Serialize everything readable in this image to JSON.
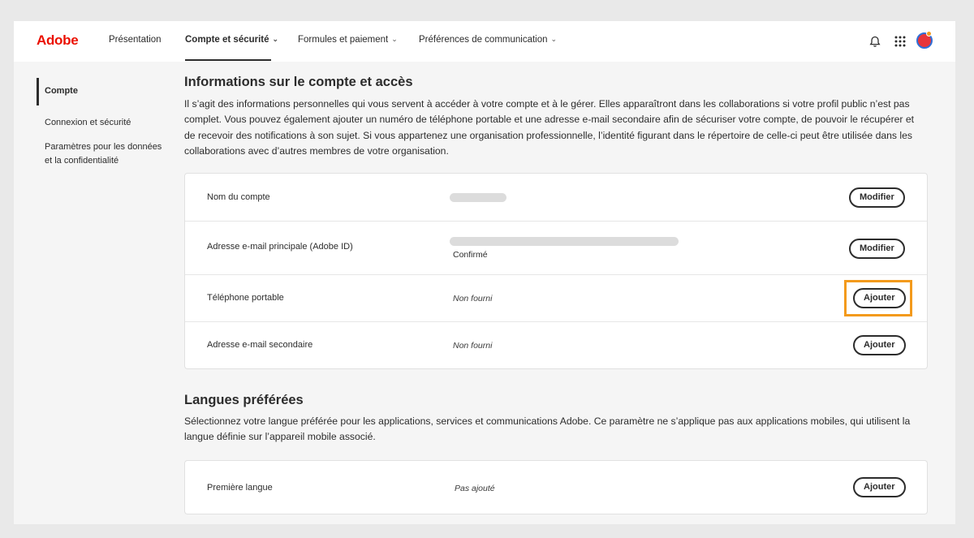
{
  "brand": {
    "name": "Adobe",
    "color": "#eb1000"
  },
  "header": {
    "nav": [
      {
        "label": "Présentation",
        "dropdown": false,
        "active": false
      },
      {
        "label": "Compte et sécurité",
        "dropdown": true,
        "active": true
      },
      {
        "label": "Formules et paiement",
        "dropdown": true,
        "active": false
      },
      {
        "label": "Préférences de communication",
        "dropdown": true,
        "active": false
      }
    ],
    "icons": [
      "bell-icon",
      "apps-grid-icon",
      "avatar"
    ]
  },
  "sidebar": {
    "items": [
      {
        "label": "Compte",
        "active": true
      },
      {
        "label": "Connexion et sécurité",
        "active": false
      },
      {
        "label": "Paramètres pour les données et la confidentialité",
        "active": false
      }
    ]
  },
  "account": {
    "title": "Informations sur le compte et accès",
    "description": "Il s’agit des informations personnelles qui vous servent à accéder à votre compte et à le gérer. Elles apparaîtront dans les collaborations si votre profil public n’est pas complet. Vous pouvez également ajouter un numéro de téléphone portable et une adresse e-mail secondaire afin de sécuriser votre compte, de pouvoir le récupérer et de recevoir des notifications à son sujet. Si vous appartenez une organisation professionnelle, l’identité figurant dans le répertoire de celle-ci peut être utilisée dans les collaborations avec d’autres membres de votre organisation.",
    "rows": [
      {
        "label": "Nom du compte",
        "value": "",
        "value_redacted": true,
        "button": "Modifier"
      },
      {
        "label": "Adresse e-mail principale (Adobe ID)",
        "value": "",
        "value_redacted": true,
        "sub_value": "Confirmé",
        "button": "Modifier"
      },
      {
        "label": "Téléphone portable",
        "value": "Non fourni",
        "button": "Ajouter",
        "highlighted": true
      },
      {
        "label": "Adresse e-mail secondaire",
        "value": "Non fourni",
        "button": "Ajouter"
      }
    ]
  },
  "languages": {
    "title": "Langues préférées",
    "description": "Sélectionnez votre langue préférée pour les applications, services et communications Adobe. Ce paramètre ne s’applique pas aux applications mobiles, qui utilisent la langue définie sur l’appareil mobile associé.",
    "rows": [
      {
        "label": "Première langue",
        "value": "Pas ajouté",
        "button": "Ajouter"
      }
    ]
  },
  "colors": {
    "highlight": "#f39a1c",
    "text": "#2c2c2c",
    "page_bg": "#f5f5f5"
  }
}
